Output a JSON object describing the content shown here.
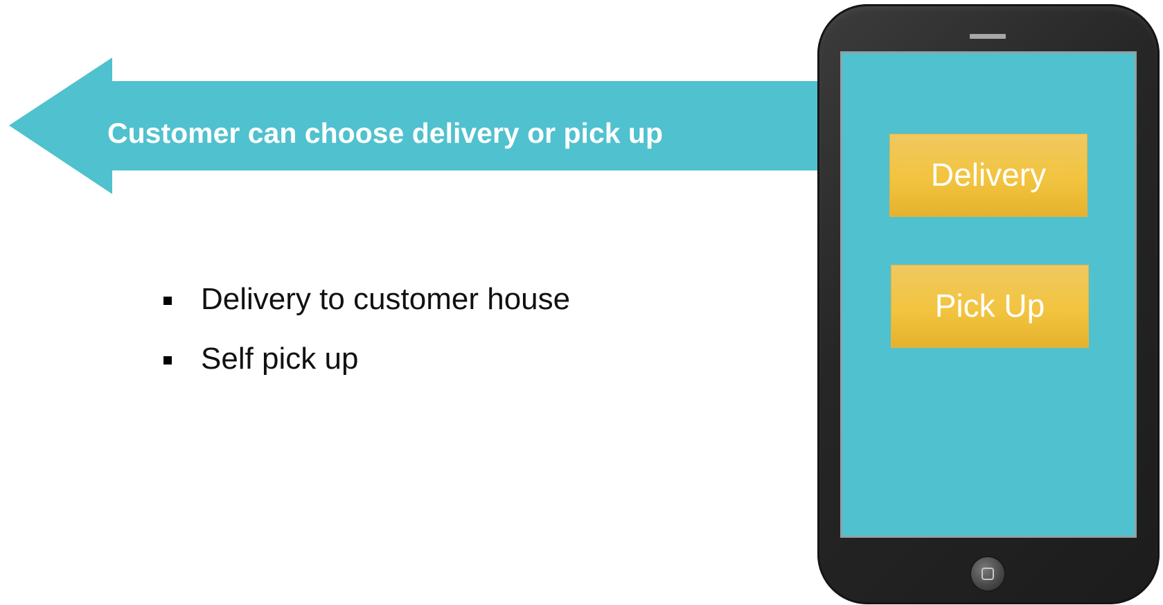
{
  "arrow": {
    "label": "Customer can choose delivery or pick up",
    "color": "#50c1ce"
  },
  "bullets": [
    "Delivery to customer house",
    "Self pick up"
  ],
  "phone": {
    "screen_color": "#50c1ce",
    "body_color": "#2a2a2a",
    "buttons": {
      "delivery": "Delivery",
      "pickup": "Pick Up"
    },
    "button_color": "#f2c43f"
  }
}
